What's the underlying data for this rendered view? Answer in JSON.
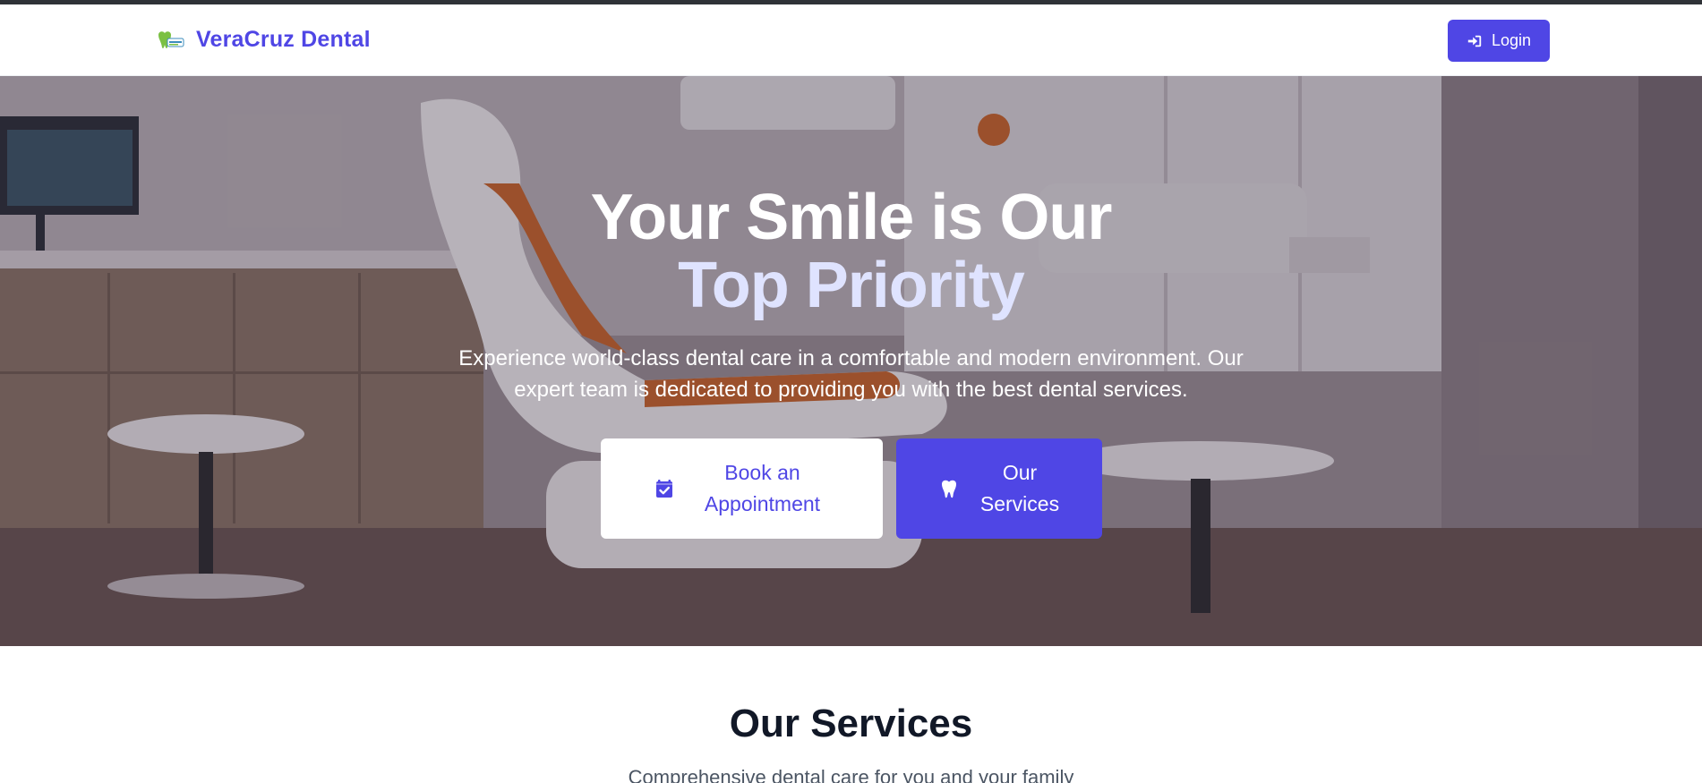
{
  "brand": {
    "name": "VeraCruz Dental",
    "logo_icon": "tooth-logo-icon"
  },
  "nav": {
    "login_label": "Login",
    "login_icon": "sign-in-icon"
  },
  "hero": {
    "title_line1": "Your Smile is Our",
    "title_line2": "Top Priority",
    "subtitle": "Experience world-class dental care in a comfortable and modern environment. Our expert team is dedicated to providing you with the best dental services.",
    "primary_button": {
      "label": "Book an Appointment",
      "icon": "calendar-check-icon"
    },
    "secondary_button": {
      "label": "Our Services",
      "icon": "tooth-icon"
    }
  },
  "services": {
    "title": "Our Services",
    "subtitle": "Comprehensive dental care for you and your family"
  },
  "colors": {
    "accent": "#4f46e5",
    "title_highlight": "#dfe3ff",
    "dark_text": "#111827"
  }
}
